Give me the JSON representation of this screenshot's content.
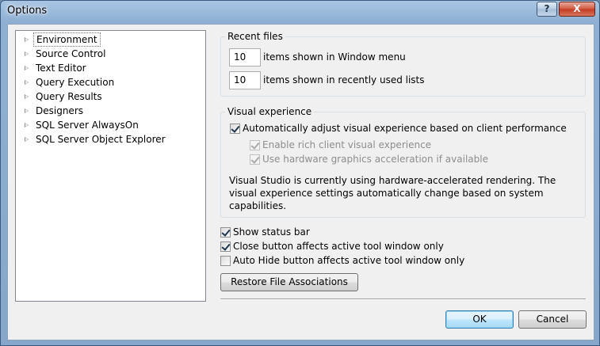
{
  "window": {
    "title": "Options",
    "help_label": "?",
    "close_label": "X"
  },
  "tree": {
    "items": [
      {
        "label": "Environment",
        "selected": true
      },
      {
        "label": "Source Control"
      },
      {
        "label": "Text Editor"
      },
      {
        "label": "Query Execution"
      },
      {
        "label": "Query Results"
      },
      {
        "label": "Designers"
      },
      {
        "label": "SQL Server AlwaysOn"
      },
      {
        "label": "SQL Server Object Explorer"
      }
    ]
  },
  "recent_files": {
    "title": "Recent files",
    "window_menu_count": "10",
    "window_menu_label": "items shown in Window menu",
    "recent_lists_count": "10",
    "recent_lists_label": "items shown in recently used lists"
  },
  "visual_experience": {
    "title": "Visual experience",
    "auto_adjust": {
      "label": "Automatically adjust visual experience based on client performance",
      "checked": true
    },
    "rich_client": {
      "label": "Enable rich client visual experience",
      "checked": true,
      "enabled": false
    },
    "hw_accel": {
      "label": "Use hardware graphics acceleration if available",
      "checked": true,
      "enabled": false
    },
    "description": "Visual Studio is currently using hardware-accelerated rendering. The visual experience settings automatically change based on system capabilities."
  },
  "options": {
    "show_status_bar": {
      "label": "Show status bar",
      "checked": true
    },
    "close_button": {
      "label": "Close button affects active tool window only",
      "checked": true
    },
    "auto_hide": {
      "label": "Auto Hide button affects active tool window only",
      "checked": false
    }
  },
  "buttons": {
    "restore": "Restore File Associations",
    "ok": "OK",
    "cancel": "Cancel"
  },
  "colors": {
    "title_bar": "#a9c6e3",
    "dialog_bg": "#f0f0f0",
    "close_button": "#c13a20",
    "default_button": "#bee6fd"
  }
}
